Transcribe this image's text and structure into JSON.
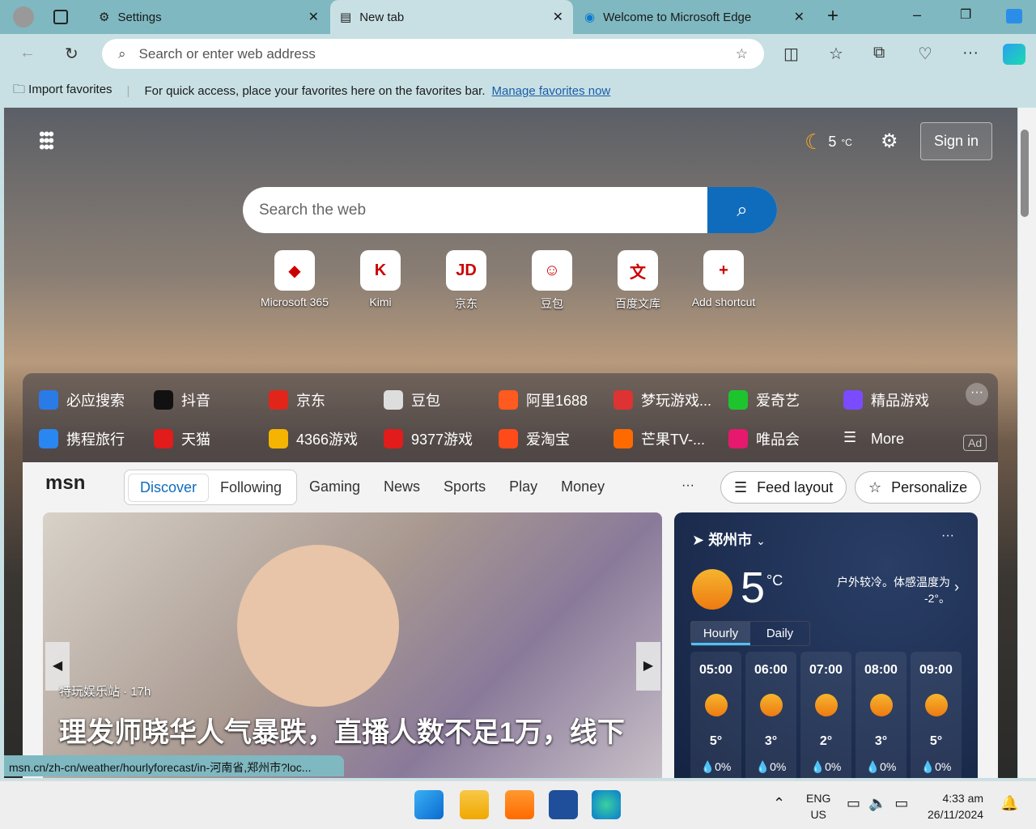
{
  "tabs": [
    {
      "label": "Settings",
      "icon": "gear-icon"
    },
    {
      "label": "New tab",
      "icon": "newtab-icon",
      "active": true
    },
    {
      "label": "Welcome to Microsoft Edge",
      "icon": "edge-icon"
    }
  ],
  "address": {
    "placeholder": "Search or enter web address"
  },
  "favorites": {
    "import": "Import favorites",
    "message": "For quick access, place your favorites here on the favorites bar.",
    "manage": "Manage favorites now"
  },
  "header": {
    "weather": "5",
    "unit": "°C",
    "sign_in": "Sign in"
  },
  "search": {
    "placeholder": "Search the web"
  },
  "shortcuts": [
    {
      "label": "Microsoft 365",
      "glyph": "◆"
    },
    {
      "label": "Kimi",
      "glyph": "K"
    },
    {
      "label": "京东",
      "glyph": "JD"
    },
    {
      "label": "豆包",
      "glyph": "☺"
    },
    {
      "label": "百度文库",
      "glyph": "文"
    },
    {
      "label": "Add shortcut",
      "glyph": "+"
    }
  ],
  "links": [
    [
      {
        "label": "必应搜索",
        "color": "#2b7be6"
      },
      {
        "label": "抖音",
        "color": "#111"
      },
      {
        "label": "京东",
        "color": "#e1251b"
      },
      {
        "label": "豆包",
        "color": "#ddd"
      },
      {
        "label": "阿里1688",
        "color": "#ff5a1f"
      },
      {
        "label": "梦玩游戏...",
        "color": "#d33"
      },
      {
        "label": "爱奇艺",
        "color": "#1ec42e"
      },
      {
        "label": "精品游戏",
        "color": "#7a4bff"
      }
    ],
    [
      {
        "label": "携程旅行",
        "color": "#2a86f0"
      },
      {
        "label": "天猫",
        "color": "#e21b1b"
      },
      {
        "label": "4366游戏",
        "color": "#f5b400"
      },
      {
        "label": "9377游戏",
        "color": "#e21b1b"
      },
      {
        "label": "爱淘宝",
        "color": "#ff4a1a"
      },
      {
        "label": "芒果TV-...",
        "color": "#ff6a00"
      },
      {
        "label": "唯品会",
        "color": "#e6196e"
      },
      {
        "label": "More",
        "color": "transparent"
      }
    ]
  ],
  "ad_label": "Ad",
  "msn": {
    "logo": "msn",
    "tabs": [
      "Discover",
      "Following"
    ],
    "nav": [
      "Gaming",
      "News",
      "Sports",
      "Play",
      "Money"
    ],
    "more": "···",
    "feed_layout": "Feed layout",
    "personalize": "Personalize"
  },
  "hero": {
    "source": "特玩娱乐站 · 17h",
    "headline": "理发师晓华人气暴跌，直播人数不足1万，线下"
  },
  "weather": {
    "city": "郑州市",
    "temp": "5",
    "unit": "°C",
    "desc": "户外较冷。体感温度为 -2°。",
    "tabs": [
      "Hourly",
      "Daily"
    ],
    "hours": [
      {
        "time": "05:00",
        "temp": "5°",
        "rain": "0%",
        "icon": "moon"
      },
      {
        "time": "06:00",
        "temp": "3°",
        "rain": "0%",
        "icon": "moon"
      },
      {
        "time": "07:00",
        "temp": "2°",
        "rain": "0%",
        "icon": "moon-cloud"
      },
      {
        "time": "08:00",
        "temp": "3°",
        "rain": "0%",
        "icon": "sun"
      },
      {
        "time": "09:00",
        "temp": "5°",
        "rain": "0%",
        "icon": "sun"
      }
    ]
  },
  "status_url": "msn.cn/zh-cn/weather/hourlyforecast/in-河南省,郑州市?loc...",
  "tray": {
    "lang1": "ENG",
    "lang2": "US",
    "time": "4:33 am",
    "date": "26/11/2024"
  }
}
